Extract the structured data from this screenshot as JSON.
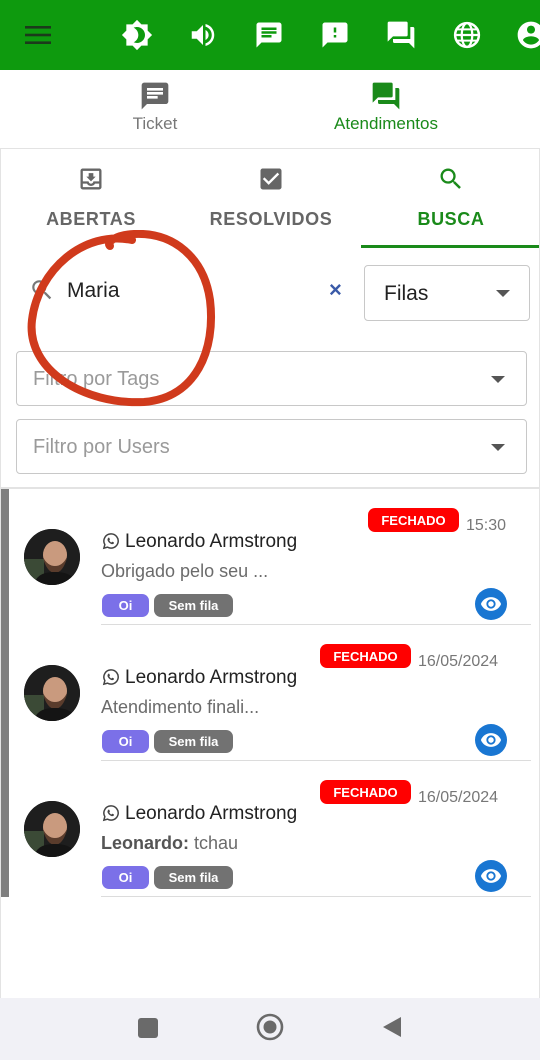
{
  "topbar": {
    "icons": [
      "menu-icon",
      "brightness-icon",
      "volume-icon",
      "chat-message-icon",
      "alert-message-icon",
      "forum-icon",
      "globe-icon",
      "account-icon"
    ],
    "color": "#0e9a0e"
  },
  "subnav": {
    "ticket_label": "Ticket",
    "atendimentos_label": "Atendimentos"
  },
  "tabs": {
    "abertas": "ABERTAS",
    "resolvidos": "RESOLVIDOS",
    "busca": "BUSCA",
    "active": "BUSCA"
  },
  "search": {
    "value": "Maria",
    "clear_symbol": "×",
    "filas_label": "Filas"
  },
  "filters": {
    "tags_placeholder": "Filtro por Tags",
    "users_placeholder": "Filtro por Users"
  },
  "tickets": [
    {
      "name": "Leonardo Armstrong",
      "preview": "Obrigado pelo seu ...",
      "preview_sender": "",
      "status": "FECHADO",
      "time": "15:30",
      "chips": [
        "Oi",
        "Sem fila"
      ]
    },
    {
      "name": "Leonardo Armstrong",
      "preview": "Atendimento finali...",
      "preview_sender": "",
      "status": "FECHADO",
      "time": "16/05/2024",
      "chips": [
        "Oi",
        "Sem fila"
      ]
    },
    {
      "name": "Leonardo Armstrong",
      "preview": "tchau",
      "preview_sender": "Leonardo:",
      "status": "FECHADO",
      "time": "16/05/2024",
      "chips": [
        "Oi",
        "Sem fila"
      ]
    }
  ],
  "colors": {
    "accent_green": "#1a8a1a",
    "status_closed": "#ff0000",
    "chip_oi": "#7b70e8",
    "chip_fila": "#727272",
    "eye_button": "#1976d2",
    "annotation_circle": "#d03a1c"
  },
  "navbar": {
    "icons": [
      "recent-apps-icon",
      "home-icon",
      "back-icon"
    ]
  }
}
